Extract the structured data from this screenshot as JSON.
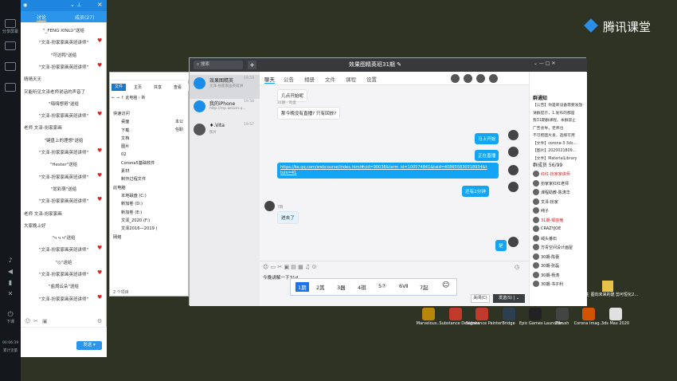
{
  "watermark": {
    "title": "腾讯课堂"
  },
  "rail": {
    "share": "分享屏幕",
    "time": "00:06:39",
    "net": "累计流量",
    "stop": "下课"
  },
  "classroom": {
    "tabs": [
      "讨论",
      "成员(27)"
    ],
    "messages": [
      {
        "text": "\"_FENG XINLU\"送给",
        "cls": "c"
      },
      {
        "text": "\"文泽-扮家家画英班讲师\"",
        "cls": "c",
        "heart": true
      },
      {
        "text": "\"可达鸭\"送给",
        "cls": "c"
      },
      {
        "text": "\"文泽-扮家家画英班讲师\"",
        "cls": "c",
        "heart": true
      },
      {
        "text": "晴晴天天",
        "cls": "l"
      },
      {
        "text": "又能听见文泽老师说话的声音了",
        "cls": "l"
      },
      {
        "text": "\"嗨嗨想哥\"送给",
        "cls": "c"
      },
      {
        "text": "\"文泽-扮家家画英班讲师\"",
        "cls": "c",
        "heart": true
      },
      {
        "text": "老师 文泽-扮家家画",
        "cls": "l"
      },
      {
        "text": "\"键盘上的理想\"送给",
        "cls": "c"
      },
      {
        "text": "\"文泽-扮家家画英班讲师\"",
        "cls": "c",
        "heart": true
      },
      {
        "text": "\"Hester\"送给",
        "cls": "c"
      },
      {
        "text": "\"文泽-扮家家画英班讲师\"",
        "cls": "c",
        "heart": true
      },
      {
        "text": "\"尚彩萌\"送给",
        "cls": "c"
      },
      {
        "text": "\"文泽-扮家家画英班讲师\"",
        "cls": "c",
        "heart": true
      },
      {
        "text": "老师 文泽-扮家家画",
        "cls": "l"
      },
      {
        "text": "大家晚上好",
        "cls": "l"
      },
      {
        "text": "\"ч ч ч\"送给",
        "cls": "c"
      },
      {
        "text": "\"文泽-扮家家画英班讲师\"",
        "cls": "c",
        "heart": true
      },
      {
        "text": "\"◎\"送给",
        "cls": "c"
      },
      {
        "text": "\"文泽-扮家家画英班讲师\"",
        "cls": "c",
        "heart": true
      },
      {
        "text": "\"盐焗云朵\"送给",
        "cls": "c"
      },
      {
        "text": "\"文泽-扮家家画英班讲师\"",
        "cls": "c",
        "heart": true
      }
    ],
    "send": "发送"
  },
  "explorer": {
    "tabs": [
      "文件",
      "主页",
      "共享",
      "查看"
    ],
    "path": "此电脑 › 新",
    "tree": [
      "快速访问",
      "桌面",
      "下载",
      "文档",
      "图片",
      "02",
      "Corona5基础软件",
      "素材",
      "制作过程文件",
      "此电脑",
      "本地磁盘 (C:)",
      "新加卷 (D:)",
      "新加卷 (E:)",
      "文泽_2020 (F:)",
      "文泽2016—2019 (",
      "网络"
    ],
    "files": [
      "本公",
      "任职"
    ],
    "status": "2 个项目"
  },
  "qq": {
    "search": "搜索",
    "title": "效果图精英班31期",
    "conversations": [
      {
        "name": "效果图精英",
        "time": "19:59",
        "preview": "文泽-扮家家画英班讲"
      },
      {
        "name": "我的iPhone",
        "time": "19:58",
        "preview": "http://mp.weixin.q..."
      },
      {
        "name": "♦.Vita",
        "time": "19:57",
        "preview": "照片"
      }
    ],
    "tabs": [
      "聊天",
      "公告",
      "相册",
      "文件",
      "课程",
      "设置"
    ],
    "messages": {
      "m1": "几点开始呢",
      "m2_sender": "31期 - 鸡蛋",
      "m2": "那今晚没有直播? 只有回放?",
      "m3": "马上开始",
      "m4": "正在直播",
      "m5_link1": "https://ke.qq.com/webcourse/index.html#cid=90038&term_id=100574841&taid=408655830318934&t",
      "m5_link2": "tuin=41",
      "m6": "还有2分钟",
      "m7_sender": "7期",
      "m7": "进去了",
      "m8": "是"
    },
    "input_text": "今晚讲解一下31d",
    "close": "关闭(C)",
    "send": "发送(S)",
    "notice_title": "群通知",
    "notice_lines": [
      "【公告】你是新设备需要发放",
      "请群提示，1.发布的都是",
      "我31期群课程。本群禁止",
      "广告会导，老师也",
      "不可把图片发，选择可用",
      "【文件】corona-3 3ds...",
      "【图片】2020021809...",
      "【文件】MaterialLibrary"
    ],
    "members_title": "群成员 56/99",
    "members": [
      "红红-扮家家讲师",
      "扮家家红红老师",
      "课程助教-陈涛华",
      "文泽-扮家",
      "纯子",
      "31期-邹亚楠",
      "CRAZYJOE",
      "绒头番石",
      "方青空间设计画屋",
      "30期-陈蕾",
      "30期-张磊",
      "30期-杨涛",
      "30期-书子利"
    ]
  },
  "ime": {
    "candidates": [
      "1期",
      "2其",
      "3器",
      "4祺",
      "5⑦",
      "6Ⅶ",
      "7起"
    ]
  },
  "desktop_icons": [
    "Marvelous...",
    "Substance Designer",
    "Substance Painter",
    "Bridge",
    "Epic Games Launcher",
    "ZBrush",
    "Corona Imag...",
    "3ds Max 2020"
  ],
  "desktop_right": "主 图向未来的建 剪可恒化2..."
}
